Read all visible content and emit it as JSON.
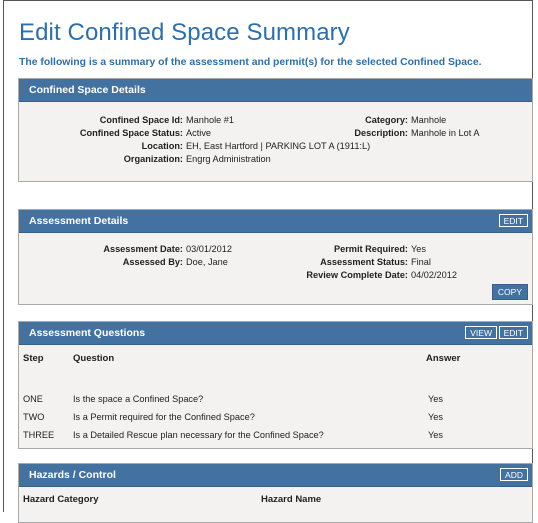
{
  "page": {
    "title": "Edit Confined Space Summary",
    "subtitle": "The following is a summary of the assessment and permit(s) for the selected Confined Space."
  },
  "space_details": {
    "header": "Confined Space Details",
    "fields": {
      "id_label": "Confined Space Id:",
      "id_value": "Manhole #1",
      "category_label": "Category:",
      "category_value": "Manhole",
      "status_label": "Confined Space Status:",
      "status_value": "Active",
      "description_label": "Description:",
      "description_value": "Manhole in Lot A",
      "location_label": "Location:",
      "location_value": "EH, East Hartford | PARKING LOT A (1911:L)",
      "organization_label": "Organization:",
      "organization_value": "Engrg Administration"
    }
  },
  "assessment": {
    "header": "Assessment Details",
    "edit_label": "EDIT",
    "copy_label": "COPY",
    "fields": {
      "date_label": "Assessment Date:",
      "date_value": "03/01/2012",
      "permit_label": "Permit Required:",
      "permit_value": "Yes",
      "assessed_by_label": "Assessed By:",
      "assessed_by_value": "Doe, Jane",
      "astatus_label": "Assessment Status:",
      "astatus_value": "Final",
      "review_label": "Review Complete Date:",
      "review_value": "04/02/2012"
    }
  },
  "questions": {
    "header": "Assessment Questions",
    "view_label": "VIEW",
    "edit_label": "EDIT",
    "columns": {
      "step": "Step",
      "question": "Question",
      "answer": "Answer"
    },
    "rows": [
      {
        "step": "ONE",
        "question": "Is the space a Confined Space?",
        "answer": "Yes"
      },
      {
        "step": "TWO",
        "question": "Is a Permit required for the Confined Space?",
        "answer": "Yes"
      },
      {
        "step": "THREE",
        "question": "Is a Detailed Rescue plan necessary for the Confined Space?",
        "answer": "Yes"
      }
    ]
  },
  "hazards": {
    "header": "Hazards / Control",
    "add_label": "ADD",
    "columns": {
      "category": "Hazard Category",
      "name": "Hazard Name"
    }
  }
}
